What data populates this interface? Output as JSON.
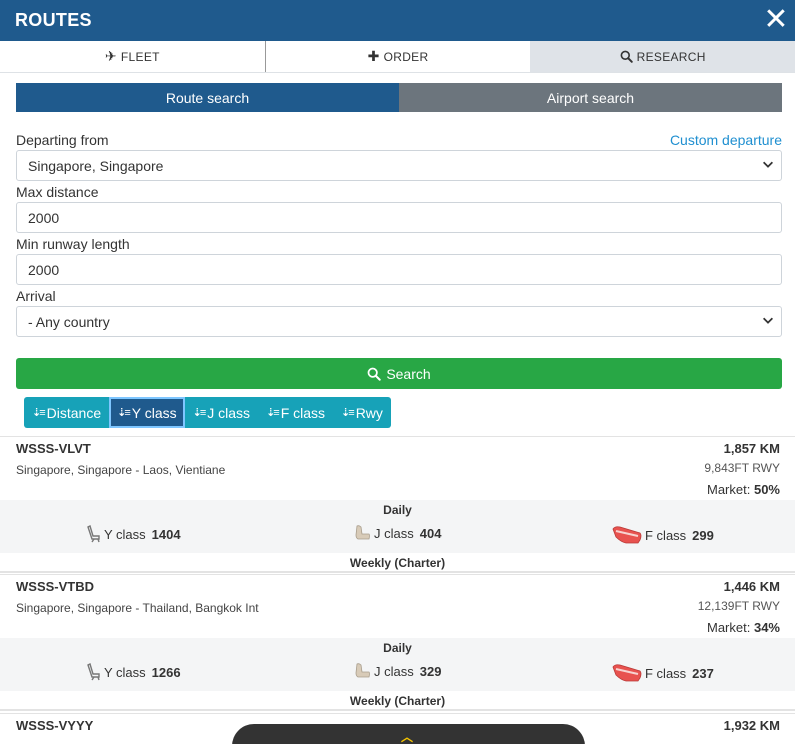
{
  "header": {
    "title": "ROUTES",
    "close_icon": "close-icon"
  },
  "tabs": [
    {
      "label": "FLEET",
      "icon": "airplane-icon"
    },
    {
      "label": "ORDER",
      "icon": "plus-icon"
    },
    {
      "label": "RESEARCH",
      "icon": "search-icon",
      "active": true
    }
  ],
  "mode": {
    "route_search": "Route search",
    "airport_search": "Airport search"
  },
  "form": {
    "departing_label": "Departing from",
    "custom_departure": "Custom departure",
    "departing_value": "Singapore, Singapore",
    "max_distance_label": "Max distance",
    "max_distance_value": "2000",
    "min_runway_label": "Min runway length",
    "min_runway_value": "2000",
    "arrival_label": "Arrival",
    "arrival_value": "- Any country",
    "search_label": "Search"
  },
  "sort": [
    {
      "label": "Distance"
    },
    {
      "label": "Y class",
      "active": true
    },
    {
      "label": "J class"
    },
    {
      "label": "F class"
    },
    {
      "label": "Rwy"
    }
  ],
  "routes": [
    {
      "code": "WSSS-VLVT",
      "path": "Singapore, Singapore - Laos, Vientiane",
      "distance": "1,857 KM",
      "runway": "9,843FT RWY",
      "market_label": "Market:",
      "market_value": "50%",
      "frequency": "Daily",
      "y_label": "Y class",
      "y_value": "1404",
      "j_label": "J class",
      "j_value": "404",
      "f_label": "F class",
      "f_value": "299",
      "weekly": "Weekly (Charter)"
    },
    {
      "code": "WSSS-VTBD",
      "path": "Singapore, Singapore - Thailand, Bangkok Int",
      "distance": "1,446 KM",
      "runway": "12,139FT RWY",
      "market_label": "Market:",
      "market_value": "34%",
      "frequency": "Daily",
      "y_label": "Y class",
      "y_value": "1266",
      "j_label": "J class",
      "j_value": "329",
      "f_label": "F class",
      "f_value": "237",
      "weekly": "Weekly (Charter)"
    },
    {
      "code": "WSSS-VYYY",
      "distance": "1,932 KM"
    }
  ],
  "colors": {
    "primary": "#1f5a8d",
    "success": "#28a745",
    "info": "#17a2b8",
    "secondary": "#6c757d",
    "link": "#1f8fd0"
  }
}
